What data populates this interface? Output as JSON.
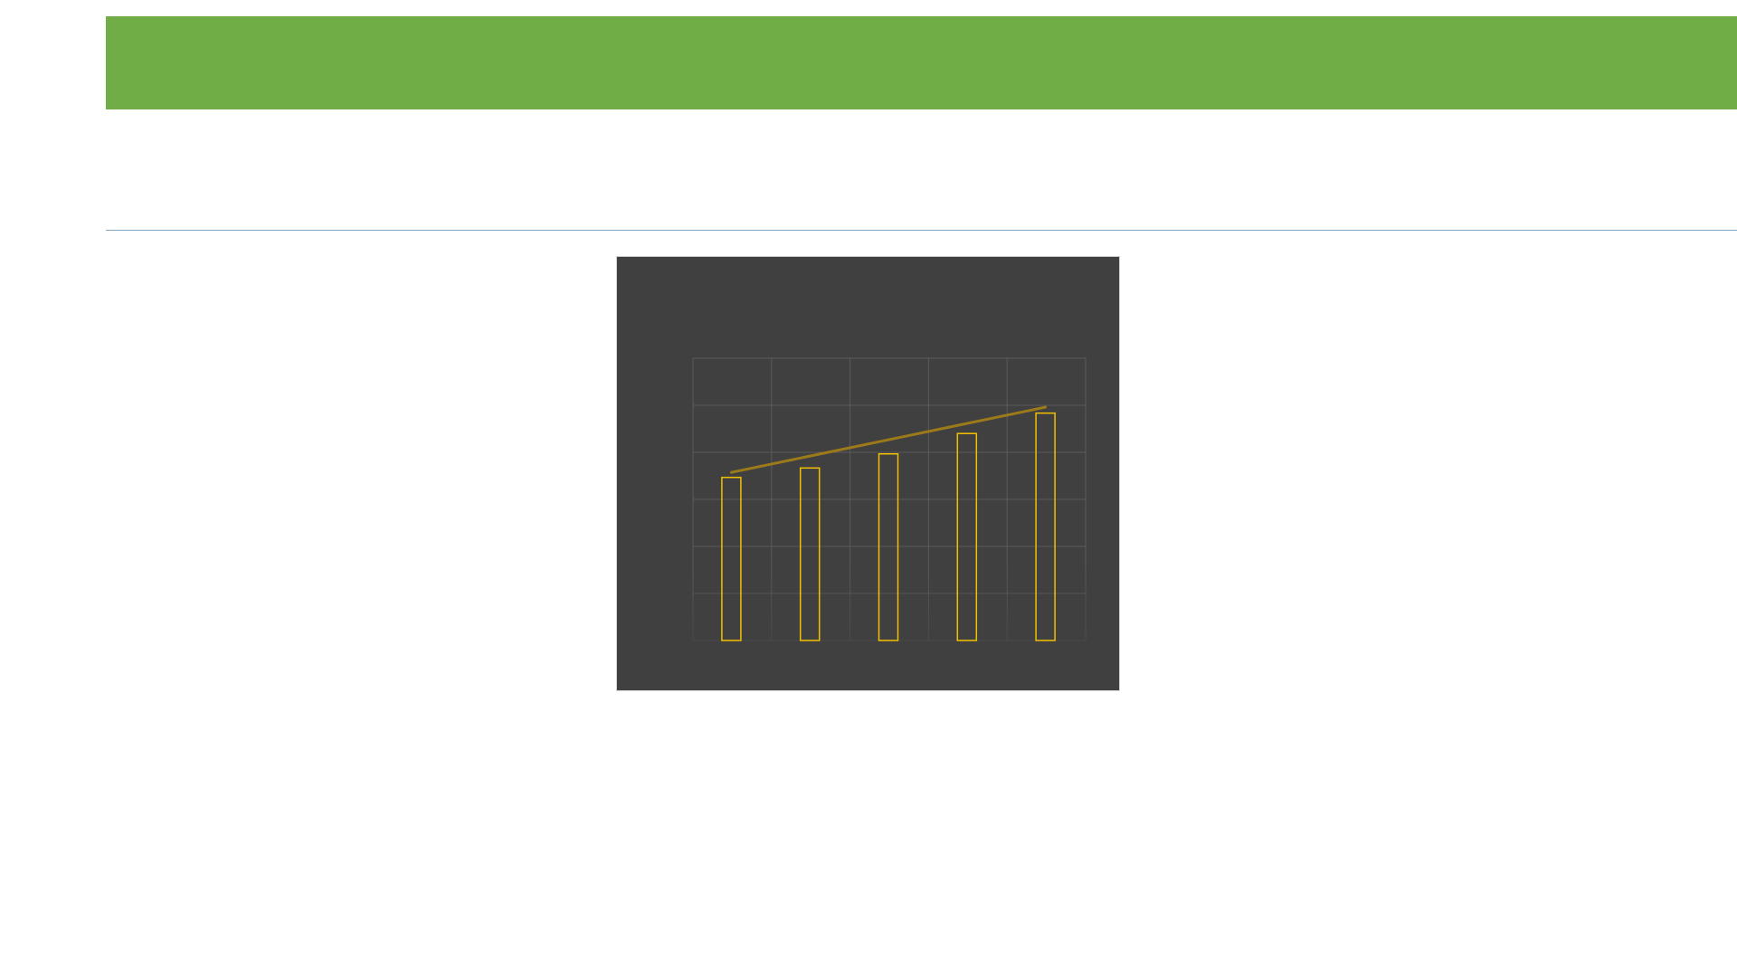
{
  "colors": {
    "banner": "#70ad47",
    "chart_background": "#404040",
    "bar_stroke": "#f2c000",
    "trend_line": "#9c7a1a",
    "grid": "#5a5a5a",
    "divider": "#7da6c4"
  },
  "chart_data": {
    "type": "bar",
    "categories": [
      "",
      "",
      "",
      "",
      ""
    ],
    "values": [
      52,
      55,
      59.5,
      66,
      72.5
    ],
    "ylim": [
      0,
      90
    ],
    "grid": true,
    "bar_style": "outline",
    "trend_line": true,
    "title": "",
    "xlabel": "",
    "ylabel": ""
  }
}
